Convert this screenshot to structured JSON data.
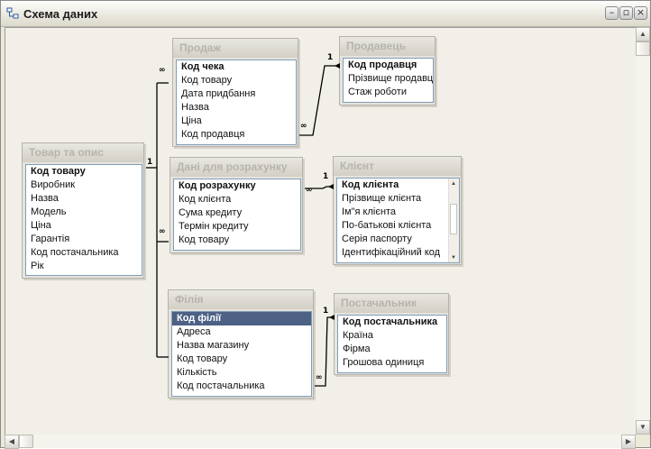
{
  "window": {
    "title": "Схема даних"
  },
  "tables": {
    "sale": {
      "title": "Продаж",
      "fields": [
        "Код чека",
        "Код товару",
        "Дата придбання",
        "Назва",
        "Ціна",
        "Код продавця"
      ]
    },
    "seller": {
      "title": "Продавець",
      "fields": [
        "Код продавця",
        "Прізвище продавця",
        "Стаж роботи"
      ]
    },
    "product": {
      "title": "Товар та опис",
      "fields": [
        "Код товару",
        "Виробник",
        "Назва",
        "Модель",
        "Ціна",
        "Гарантія",
        "Код постачальника",
        "Рік"
      ]
    },
    "calc": {
      "title": "Дані для розрахунку",
      "fields": [
        "Код розрахунку",
        "Код клієнта",
        "Сума кредиту",
        "Термін кредиту",
        "Код товару"
      ]
    },
    "client": {
      "title": "Клієнт",
      "fields": [
        "Код клієнта",
        "Прізвище  клієнта",
        "Ім\"я  клієнта",
        "По-батькові  клієнта",
        "Серія паспорту",
        "Ідентифікаційний код"
      ]
    },
    "branch": {
      "title": "Філія",
      "fields": [
        "Код філії",
        "Адреса",
        "Назва магазину",
        "Код товару",
        "Кількість",
        "Код постачальника"
      ]
    },
    "supplier": {
      "title": "Постачальник",
      "fields": [
        "Код постачальника",
        "Країна",
        "Фірма",
        "Грошова одиниця"
      ]
    }
  },
  "cardinality": {
    "one": "1",
    "many": "∞"
  }
}
